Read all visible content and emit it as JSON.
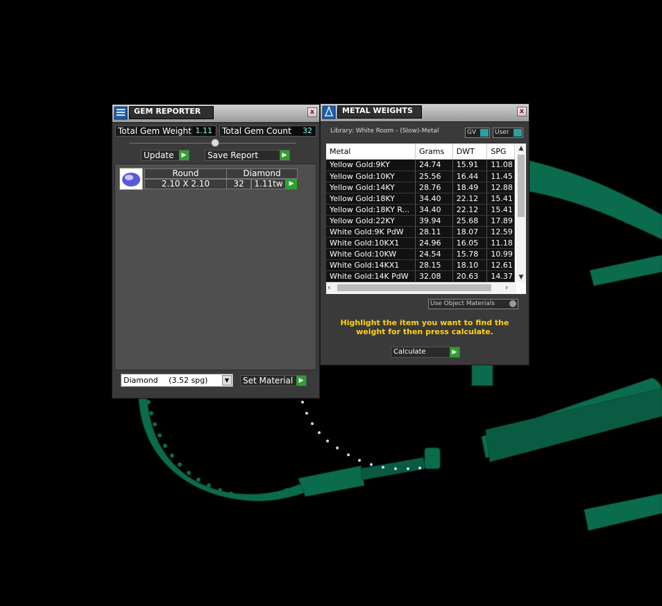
{
  "gem_reporter": {
    "title": "GEM REPORTER",
    "close": "x",
    "total_gem_weight_label": "Total Gem Weight",
    "total_gem_weight_value": "1.11",
    "total_gem_count_label": "Total Gem Count",
    "total_gem_count_value": "32",
    "update_label": "Update",
    "save_report_label": "Save Report",
    "gem": {
      "shape": "Round",
      "material": "Diamond",
      "size": "2.10 X 2.10",
      "count": "32",
      "weight": "1.11tw"
    },
    "material_select": {
      "name": "Diamond",
      "spg": "(3.52 spg)"
    },
    "set_material_label": "Set Material"
  },
  "metal_weights": {
    "title": "METAL WEIGHTS",
    "close": "x",
    "library": "Library: White Room - (Slow)-Metal",
    "gv_label": "GV",
    "user_label": "User",
    "columns": [
      "Metal",
      "Grams",
      "DWT",
      "SPG"
    ],
    "rows": [
      [
        "Yellow Gold:9KY",
        "24.74",
        "15.91",
        "11.08"
      ],
      [
        "Yellow Gold:10KY",
        "25.56",
        "16.44",
        "11.45"
      ],
      [
        "Yellow Gold:14KY",
        "28.76",
        "18.49",
        "12.88"
      ],
      [
        "Yellow Gold:18KY",
        "34.40",
        "22.12",
        "15.41"
      ],
      [
        "Yellow Gold:18KY R...",
        "34.40",
        "22.12",
        "15.41"
      ],
      [
        "Yellow Gold:22KY",
        "39.94",
        "25.68",
        "17.89"
      ],
      [
        "White Gold:9K PdW",
        "28.11",
        "18.07",
        "12.59"
      ],
      [
        "White Gold:10KX1",
        "24.96",
        "16.05",
        "11.18"
      ],
      [
        "White Gold:10KW",
        "24.54",
        "15.78",
        "10.99"
      ],
      [
        "White Gold:14KX1",
        "28.15",
        "18.10",
        "12.61"
      ],
      [
        "White Gold:14K PdW",
        "32.08",
        "20.63",
        "14.37"
      ]
    ],
    "use_object_materials_label": "Use Object Materials",
    "hint": "Highlight the item you want to find the weight for then press calculate.",
    "calculate_label": "Calculate"
  },
  "colors": {
    "accent_green": "#2ea02e",
    "model_green": "#0b6b4d",
    "hint_yellow": "#ffd21a"
  }
}
